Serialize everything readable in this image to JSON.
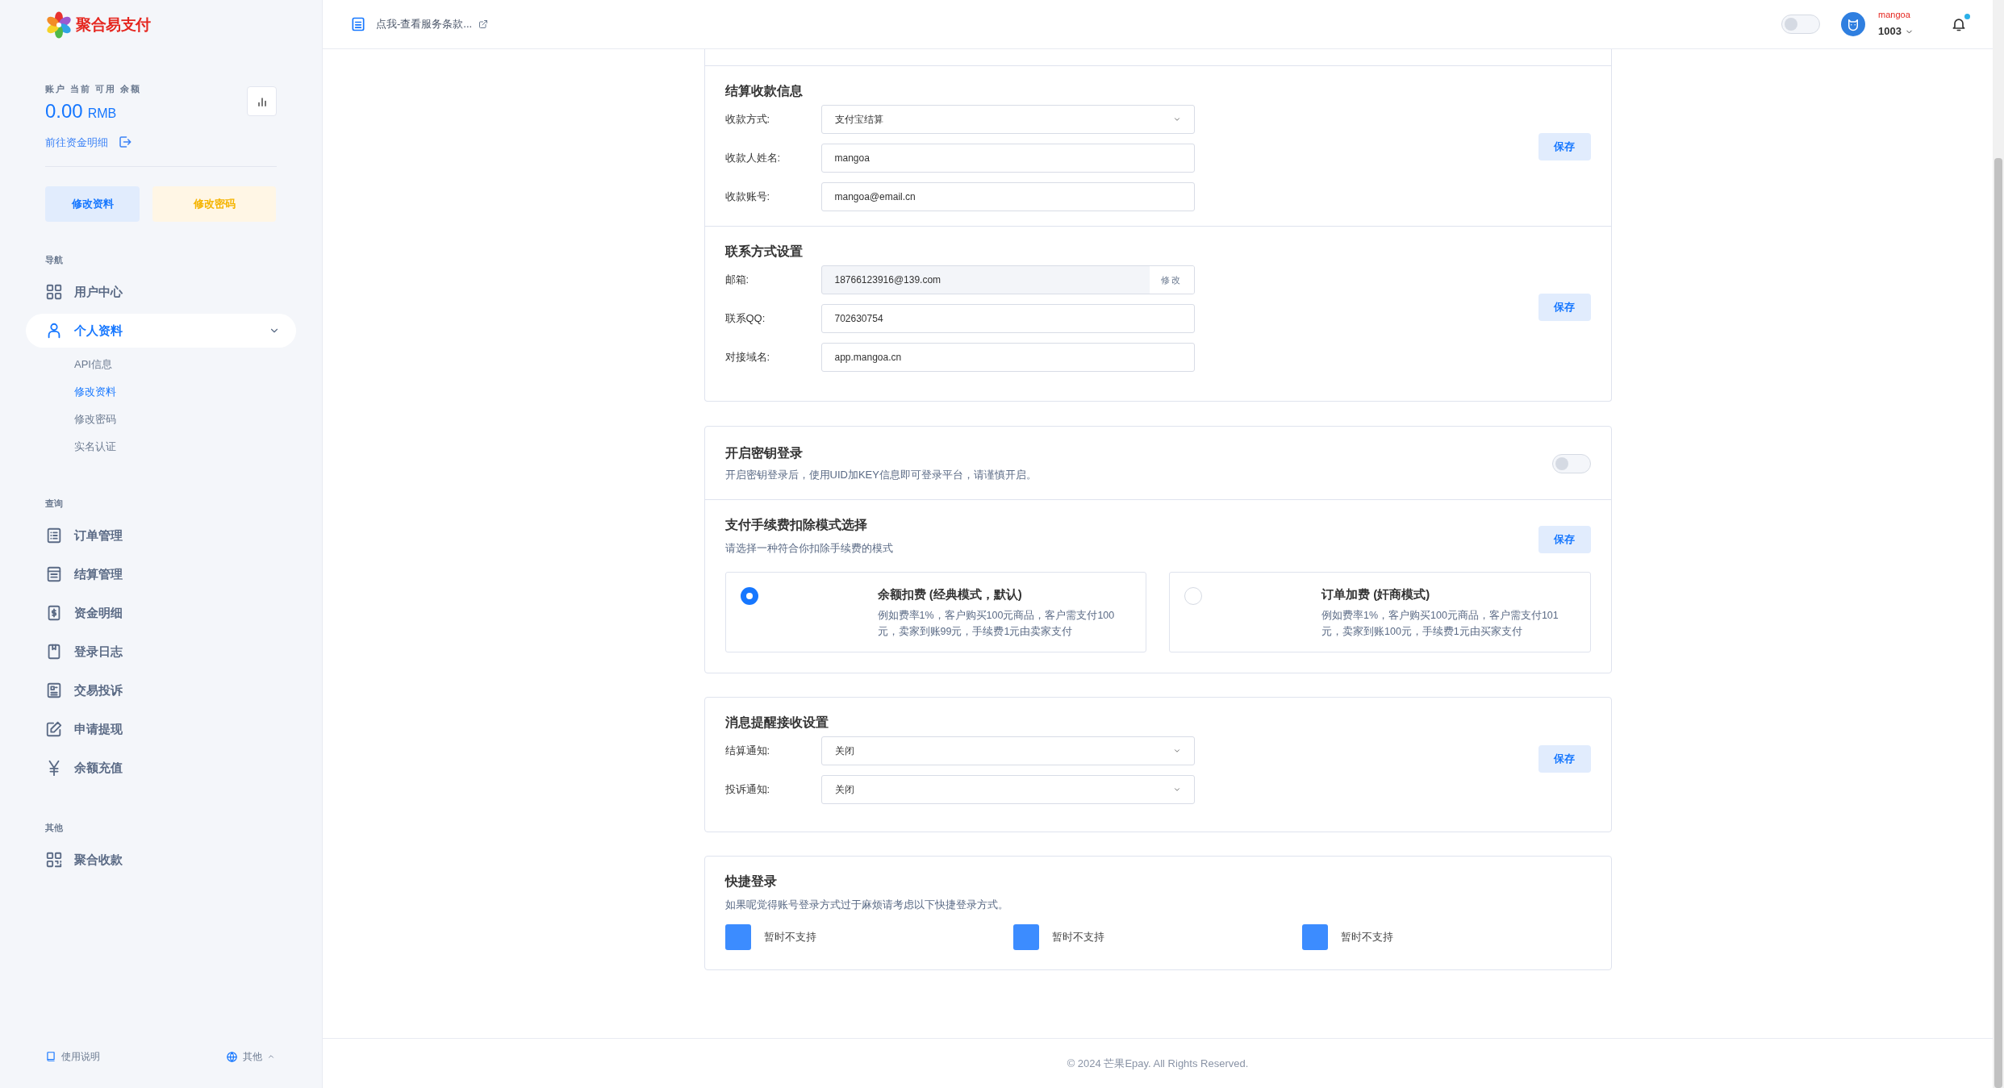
{
  "sidebar": {
    "logo_text": "聚合易支付",
    "balance": {
      "label": "账户 当前 可用 余额",
      "amount": "0.00",
      "unit": "RMB",
      "link": "前往资金明细"
    },
    "buttons": [
      {
        "label": "修改资料",
        "kind": "primary"
      },
      {
        "label": "修改密码",
        "kind": "warning"
      }
    ],
    "nav_groups": [
      {
        "heading": "导航",
        "items": [
          {
            "label": "用户中心",
            "selected": false
          },
          {
            "label": "个人资料",
            "selected": true,
            "expanded": true,
            "children": [
              {
                "label": "API信息",
                "selected": false
              },
              {
                "label": "修改资料",
                "selected": true
              },
              {
                "label": "修改密码",
                "selected": false
              },
              {
                "label": "实名认证",
                "selected": false
              }
            ]
          }
        ]
      },
      {
        "heading": "查询",
        "items": [
          {
            "label": "订单管理",
            "selected": false
          },
          {
            "label": "结算管理",
            "selected": false
          },
          {
            "label": "资金明细",
            "selected": false
          },
          {
            "label": "登录日志",
            "selected": false
          },
          {
            "label": "交易投诉",
            "selected": false
          },
          {
            "label": "申请提现",
            "selected": false
          },
          {
            "label": "余额充值",
            "selected": false
          }
        ]
      },
      {
        "heading": "其他",
        "items": [
          {
            "label": "聚合收款",
            "selected": false
          }
        ]
      }
    ],
    "footer": {
      "help": "使用说明",
      "language": "其他"
    }
  },
  "header": {
    "notice": "点我-查看服务条款...",
    "theme_toggle": {
      "on": false
    },
    "user": {
      "name": "mangoa",
      "id": "1003"
    },
    "notification_dot": true
  },
  "settlement": {
    "title": "结算收款信息",
    "save": "保存",
    "fields": [
      {
        "label": "收款方式:",
        "kind": "select",
        "value": "支付宝结算"
      },
      {
        "label": "收款人姓名:",
        "kind": "input",
        "value": "mangoa"
      },
      {
        "label": "收款账号:",
        "kind": "input",
        "value": "mangoa@email.cn"
      }
    ]
  },
  "contact": {
    "title": "联系方式设置",
    "save": "保存",
    "fields": [
      {
        "label": "邮箱:",
        "kind": "locked",
        "value": "18766123916@139.com",
        "action": "修改"
      },
      {
        "label": "联系QQ:",
        "kind": "input",
        "value": "702630754"
      },
      {
        "label": "对接域名:",
        "kind": "input",
        "value": "app.mangoa.cn"
      }
    ]
  },
  "key_login": {
    "title": "开启密钥登录",
    "description": "开启密钥登录后，使用UID加KEY信息即可登录平台，请谨慎开启。",
    "on": false
  },
  "fee_mode": {
    "title": "支付手续费扣除模式选择",
    "description": "请选择一种符合你扣除手续费的模式",
    "save": "保存",
    "options": [
      {
        "title": "余额扣费 (经典模式，默认)",
        "description": "例如费率1%，客户购买100元商品，客户需支付100元，卖家到账99元，手续费1元由卖家支付",
        "selected": true
      },
      {
        "title": "订单加费 (奸商模式)",
        "description": "例如费率1%，客户购买100元商品，客户需支付101元，卖家到账100元，手续费1元由买家支付",
        "selected": false
      }
    ]
  },
  "notifications": {
    "title": "消息提醒接收设置",
    "save": "保存",
    "fields": [
      {
        "label": "结算通知:",
        "kind": "select",
        "value": "关闭"
      },
      {
        "label": "投诉通知:",
        "kind": "select",
        "value": "关闭"
      }
    ]
  },
  "quick_login": {
    "title": "快捷登录",
    "description": "如果呢觉得账号登录方式过于麻烦请考虑以下快捷登录方式。",
    "methods": [
      {
        "label": "暂时不支持"
      },
      {
        "label": "暂时不支持"
      },
      {
        "label": "暂时不支持"
      }
    ]
  },
  "footer": "© 2024 芒果Epay. All Rights Reserved."
}
